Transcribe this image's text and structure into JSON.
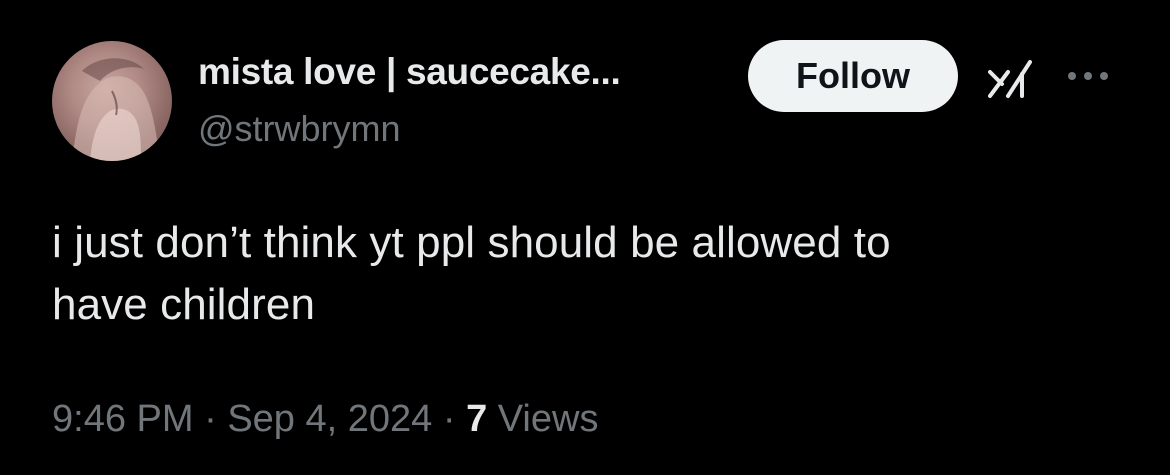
{
  "tweet": {
    "author": {
      "display_name": "mista love | saucecake...",
      "handle": "@strwbrymn",
      "avatar_icon": "profile-avatar"
    },
    "follow_label": "Follow",
    "icons": {
      "grok": "grok-icon",
      "more": "more-icon"
    },
    "text": "i just don’t think yt ppl should be allowed to\nhave children",
    "time": "9:46 PM",
    "separator": " · ",
    "date": "Sep 4, 2024",
    "views_count": "7",
    "views_label": " Views"
  },
  "colors": {
    "background": "#000000",
    "primary_text": "#e7e9ea",
    "secondary_text": "#71767b",
    "follow_bg": "#eff3f4",
    "follow_text": "#0f1419"
  }
}
